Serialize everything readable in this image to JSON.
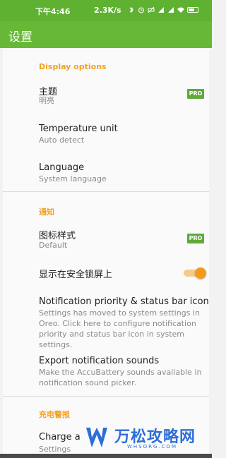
{
  "status_bar": {
    "time": "下午4:46",
    "net_speed": "2.3K/s",
    "icons": [
      "bluetooth-icon",
      "alarm-icon",
      "mute-icon",
      "signal-icon",
      "signal-icon",
      "wifi-icon",
      "battery-icon"
    ]
  },
  "app_bar": {
    "title": "设置"
  },
  "sections": {
    "display": {
      "header": "Display options",
      "theme": {
        "title": "主题",
        "subtitle": "明亮",
        "badge": "PRO"
      },
      "temperature": {
        "title": "Temperature unit",
        "subtitle": "Auto detect"
      },
      "language": {
        "title": "Language",
        "subtitle": "System language"
      }
    },
    "notification": {
      "header": "通知",
      "icon_style": {
        "title": "图标样式",
        "subtitle": "Default",
        "badge": "PRO"
      },
      "lockscreen": {
        "title": "显示在安全锁屏上",
        "enabled": true
      },
      "priority": {
        "title": "Notification priority & status bar icon",
        "subtitle_lines": [
          "Settings has moved to system settings in",
          "Oreo. Click here to configure notification",
          "priority and status bar icon in system settings."
        ]
      },
      "export": {
        "title": "Export notification sounds",
        "subtitle_lines": [
          "Make the AccuBattery sounds available in",
          "notification sound picker."
        ]
      }
    },
    "charge_alarm": {
      "header": "充电警报",
      "charge_row": {
        "title": "Charge a",
        "subtitle": "Settings"
      }
    }
  },
  "watermark": {
    "text": "万松攻略网",
    "sub": "WHSORG.COM"
  },
  "colors": {
    "status_bar": "#5fb132",
    "app_bar": "#67b836",
    "section_header": "#f4a024",
    "pro_badge": "#5faa3a",
    "toggle_on": "#f39a1a"
  }
}
